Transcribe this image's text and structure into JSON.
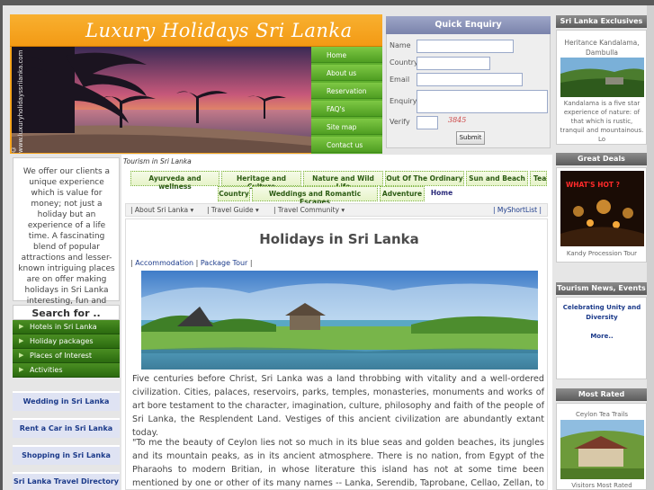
{
  "site": {
    "logo": "Luxury Holidays Sri Lanka",
    "watermark": "© www.luxuryholidayssrilanka.com"
  },
  "nav": [
    "Home",
    "About us",
    "Reservation",
    "FAQ's",
    "Site map",
    "Contact us"
  ],
  "quick_enquiry": {
    "title": "Quick Enquiry",
    "labels": {
      "name": "Name",
      "country": "Country",
      "email": "Email",
      "enquiry": "Enquiry",
      "verify": "Verify"
    },
    "captcha": "3845",
    "submit": "Submit"
  },
  "intro": "We offer our clients a unique experience which is value for money; not just a holiday but an experience of a life time. A fascinating blend of popular attractions and lesser-known intriguing places are on offer making holidays in Sri Lanka interesting, fun and unique.",
  "search": {
    "title": "Search for ..",
    "items": [
      "Hotels in Sri Lanka",
      "Holiday packages",
      "Places of Interest",
      "Activities"
    ]
  },
  "left_links": [
    "Wedding in Sri Lanka",
    "Rent a Car in Sri Lanka",
    "Shopping in Sri Lanka",
    "Sri Lanka Travel Directory"
  ],
  "breadcrumb": "Tourism in Sri Lanka",
  "tabs_row1": [
    "Ayurveda and wellness",
    "Heritage and Culture",
    "Nature and Wild Life",
    "Out Of The Ordinary",
    "Sun and Beach",
    "Tea"
  ],
  "tabs_row2": [
    "Country",
    "Weddings and Romantic Escapes",
    "Adventure",
    "Home"
  ],
  "subnav": [
    "About Sri Lanka",
    "Travel Guide",
    "Travel Community"
  ],
  "shortlist": "| MyShortList |",
  "heading": "Holidays in Sri Lanka",
  "content_links": [
    "Accommodation",
    "Package Tour"
  ],
  "paragraph1": "Five centuries before Christ, Sri Lanka was a land throbbing with vitality and a well-ordered civilization. Cities, palaces, reservoirs, parks, temples, monasteries, monuments and works of art bore testament to the character, imagination, culture, philosophy and faith of the people of Sri Lanka, the Resplendent Land. Vestiges of this ancient civilization are abundantly extant today.",
  "paragraph2": "\"To me the beauty of Ceylon lies not so much in its blue seas and golden beaches, its jungles and its mountain peaks, as in its ancient atmosphere. There is no nation, from Egypt of the Pharaohs to modern Britian, in whose literature this island has not at some time been mentioned by one or other of its many names -- Lanka, Serendib, Taprobane, Cellao, Zellan, to recall a few. History",
  "right": {
    "exclusives": {
      "title": "Sri Lanka Exclusives",
      "name": "Heritance Kandalama, Dambulla",
      "desc": "Kandalama is a five star experience of nature: of that which is rustic, tranquil and mountainous. Lo"
    },
    "deals": {
      "title": "Great Deals",
      "badge": "WHAT'S HOT ?",
      "caption": "Kandy Procession Tour"
    },
    "news": {
      "title": "Tourism News, Events",
      "headline": "Celebrating Unity and Diversity",
      "more": "More.."
    },
    "rated": {
      "title": "Most Rated",
      "name": "Ceylon Tea Trails",
      "caption": "Visitors Most Rated Property"
    }
  },
  "colors": {
    "orange": "#f7a51d",
    "green": "#5fae2e",
    "blue_link": "#1b3a8a"
  }
}
